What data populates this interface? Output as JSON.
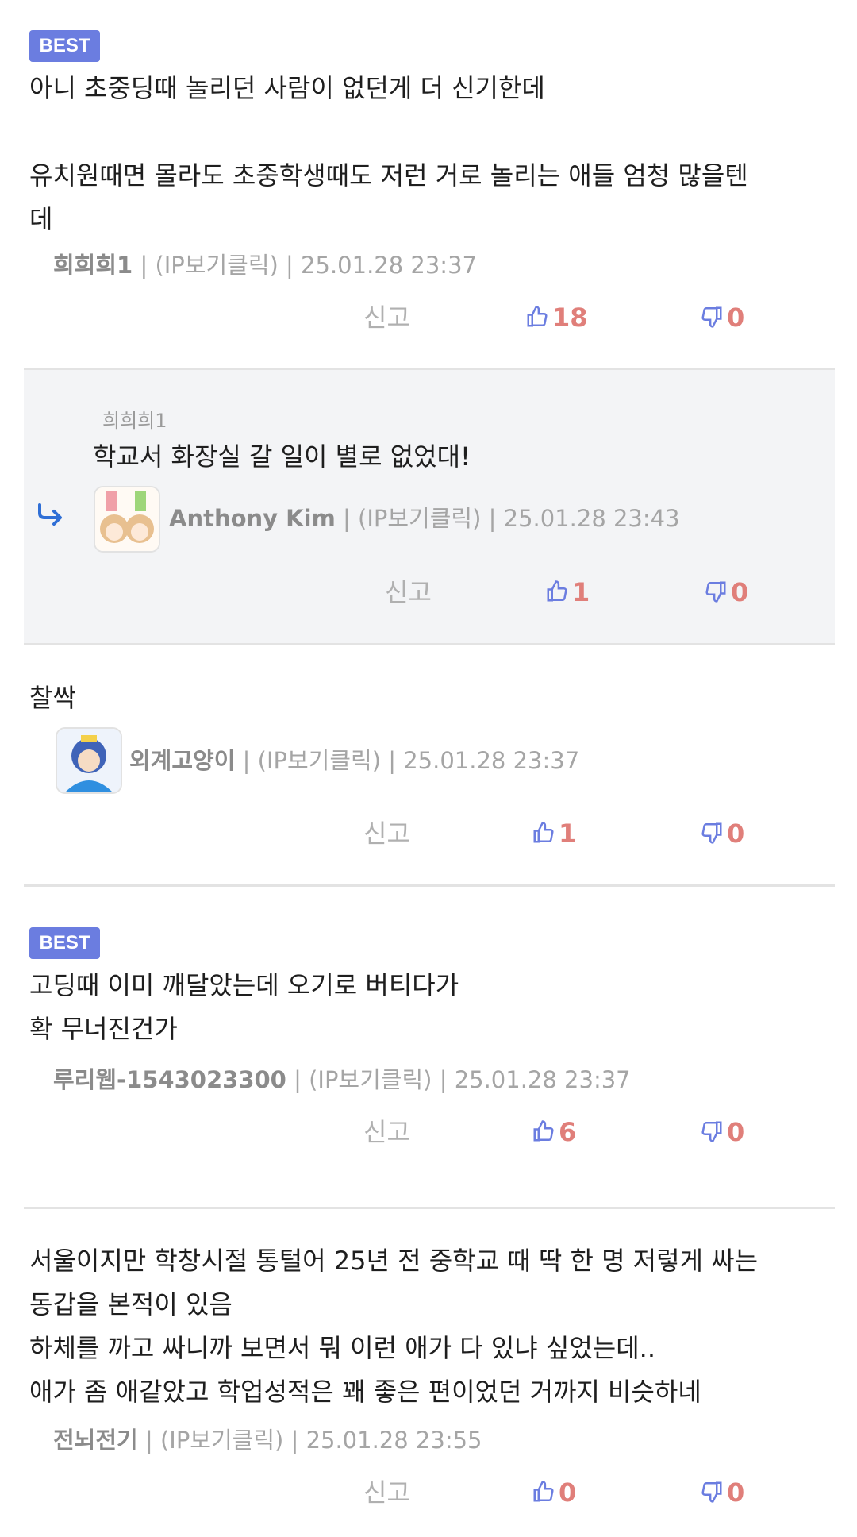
{
  "colors": {
    "best_badge": "#6b7de0",
    "vote": "#e07f7a",
    "reply_bg": "#f3f4f6"
  },
  "comments": [
    {
      "best": "BEST",
      "text": "아니 초중딩때 놀리던 사람이 없던게 더 신기한데\n\n유치원때면 몰라도 초중학생때도 저런 거로 놀리는 애들 엄청 많을텐\n데",
      "nick": "희희희1",
      "ip": "(IP보기클릭)",
      "date": "25.01.28 23:37",
      "report": "신고",
      "likes": "18",
      "dislikes": "0"
    },
    {
      "reply_to": "희희희1",
      "text": "학교서 화장실 갈 일이 별로 없었대!",
      "nick": "Anthony Kim",
      "ip": "(IP보기클릭)",
      "date": "25.01.28 23:43",
      "report": "신고",
      "likes": "1",
      "dislikes": "0"
    },
    {
      "text": "찰싹",
      "nick": "외계고양이",
      "ip": "(IP보기클릭)",
      "date": "25.01.28 23:37",
      "report": "신고",
      "likes": "1",
      "dislikes": "0"
    },
    {
      "best": "BEST",
      "text": "고딩때 이미 깨달았는데 오기로 버티다가\n확 무너진건가",
      "nick": "루리웹-1543023300",
      "ip": "(IP보기클릭)",
      "date": "25.01.28 23:37",
      "report": "신고",
      "likes": "6",
      "dislikes": "0"
    },
    {
      "text": "서울이지만 학창시절 통털어 25년 전 중학교 때 딱 한 명 저렇게 싸는\n동갑을 본적이 있음\n하체를 까고 싸니까 보면서 뭐 이런 애가 다 있냐 싶었는데..\n애가 좀 애같았고 학업성적은 꽤 좋은 편이었던 거까지 비슷하네",
      "nick": "전뇌전기",
      "ip": "(IP보기클릭)",
      "date": "25.01.28 23:55",
      "report": "신고",
      "likes": "0",
      "dislikes": "0"
    }
  ]
}
